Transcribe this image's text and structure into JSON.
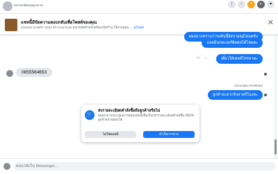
{
  "header": {
    "page_name": "ตลาดรถมือสองทุกสภาพ",
    "icons": [
      "grid-icon",
      "messenger-icon",
      "notification-icon",
      "profile-icon",
      "chevron-down-icon"
    ]
  },
  "banner": {
    "title": "แชทนี้มีข้อความตอบกลับเพื่อโพสต์ของคุณ",
    "description": "SUZUKI CARRY 2023 รถ Food truck อุปกรณ์ครัวครบพร้อมเปิดร้าน ใช้งานน้อย... ·",
    "link": "ดูโพสต์",
    "close": "✕"
  },
  "chat": {
    "messages": [
      {
        "side": "out",
        "text": "ผมอยากทราบว่ารถคันนี้ยังขายอยู่ไหมครับ"
      },
      {
        "side": "out",
        "text": "แอดมินขอเบอร์ติดต่อได้ไหมคะ"
      },
      {
        "side": "out",
        "text": "เดี๋ยวให้เซลล์โทรหาคะ"
      },
      {
        "side": "in",
        "text": "0855564653"
      },
      {
        "side": "out",
        "sender": "Chonnikan Pimkham",
        "text": "ลูกค้าสะดวกรับสายกี่โมงคะ"
      }
    ],
    "sender_name": "Chonnikan Pimkham"
  },
  "popup": {
    "title": "ส่งรายละเอียดคำสั่งซื้อถึงลูกค้าหรือไม่",
    "body": "คุณสามารถระบุผลการตอบกลับนี้เพื่อเก็บเข้ารายละเอียดคำสั่งซื้อ เพื่อให้ลูกค้าตรวจสอบได้",
    "secondary_button": "ไม่ใช่ตอนนี้",
    "primary_button": "สำเร็จการขาย"
  },
  "composer": {
    "placeholder": "ตอบกลับใน Messenger..."
  },
  "colors": {
    "accent": "#1877f2",
    "incoming_bubble": "#e4e6eb",
    "secondary_text": "#65676b"
  }
}
